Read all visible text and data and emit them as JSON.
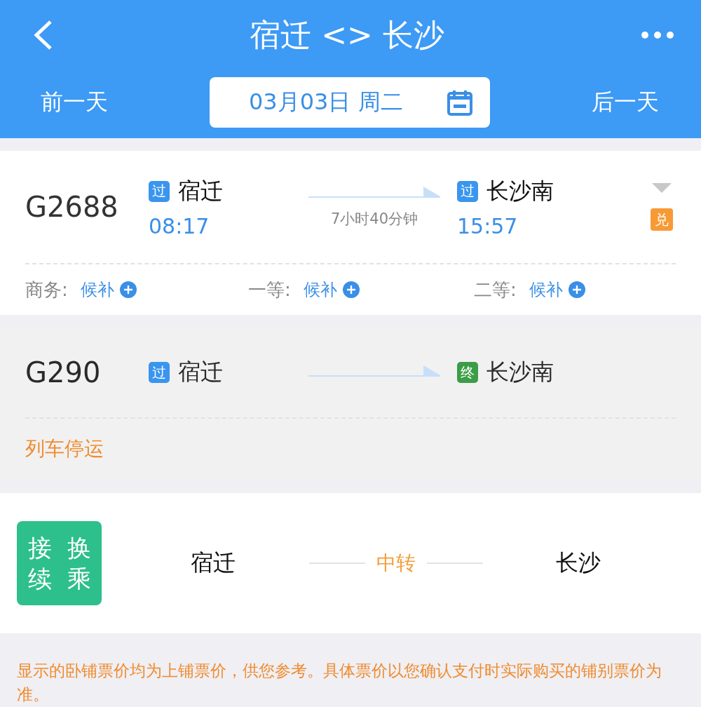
{
  "header": {
    "title": "宿迁 <> 长沙",
    "prev_day": "前一天",
    "date": "03月03日 周二",
    "next_day": "后一天"
  },
  "trains": [
    {
      "number": "G2688",
      "disabled": false,
      "from": {
        "badge": "过",
        "color": "#3a95ee",
        "station": "宿迁"
      },
      "to": {
        "badge": "过",
        "color": "#3a95ee",
        "station": "长沙南"
      },
      "depart": "08:17",
      "arrive": "15:57",
      "duration": "7小时40分钟",
      "expandable": true,
      "tag": "兑",
      "seats": [
        {
          "class": "商务:",
          "status": "候补"
        },
        {
          "class": "一等:",
          "status": "候补"
        },
        {
          "class": "二等:",
          "status": "候补"
        }
      ]
    },
    {
      "number": "G290",
      "disabled": true,
      "from": {
        "badge": "过",
        "color": "#3a95ee",
        "station": "宿迁"
      },
      "to": {
        "badge": "终",
        "color": "#3c9d47",
        "station": "长沙南"
      },
      "status": "列车停运"
    }
  ],
  "transfer": {
    "badge_columns": [
      "接续",
      "换乘"
    ],
    "from": "宿迁",
    "via": "中转",
    "to": "长沙"
  },
  "notice": "显示的卧铺票价均为上铺票价，供您参考。具体票价以您确认支付时实际购买的铺别票价为准。"
}
